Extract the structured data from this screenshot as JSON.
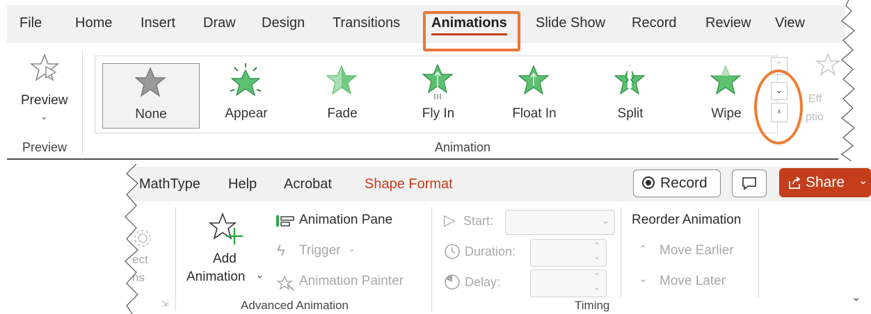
{
  "top_tabs": [
    "File",
    "Home",
    "Insert",
    "Draw",
    "Design",
    "Transitions",
    "Animations",
    "Slide Show",
    "Record",
    "Review",
    "View"
  ],
  "active_tab": "Animations",
  "preview": {
    "label": "Preview",
    "group_label": "Preview"
  },
  "animation_gallery": {
    "items": [
      {
        "label": "None",
        "icon": "star-none-icon"
      },
      {
        "label": "Appear",
        "icon": "star-appear-icon"
      },
      {
        "label": "Fade",
        "icon": "star-fade-icon"
      },
      {
        "label": "Fly In",
        "icon": "star-fly-in-icon"
      },
      {
        "label": "Float In",
        "icon": "star-float-in-icon"
      },
      {
        "label": "Split",
        "icon": "star-split-icon"
      },
      {
        "label": "Wipe",
        "icon": "star-wipe-icon"
      }
    ],
    "group_label": "Animation"
  },
  "effect_options_partial": [
    "Eff",
    "ptio"
  ],
  "bottom_tabs": [
    "MathType",
    "Help",
    "Acrobat",
    "Shape Format"
  ],
  "record_button": "Record",
  "share_button": "Share",
  "effect_partial_lower": [
    "ect",
    "ns"
  ],
  "advanced_animation": {
    "add_animation": [
      "Add",
      "Animation"
    ],
    "animation_pane": "Animation Pane",
    "trigger": "Trigger",
    "animation_painter": "Animation Painter",
    "group_label": "Advanced Animation"
  },
  "timing": {
    "start": "Start:",
    "duration": "Duration:",
    "delay": "Delay:",
    "group_label": "Timing"
  },
  "reorder": {
    "title": "Reorder Animation",
    "move_earlier": "Move Earlier",
    "move_later": "Move Later"
  },
  "colors": {
    "accent": "#c43e1c",
    "highlight": "#ed7d31",
    "star_green": "#5cc16f"
  }
}
